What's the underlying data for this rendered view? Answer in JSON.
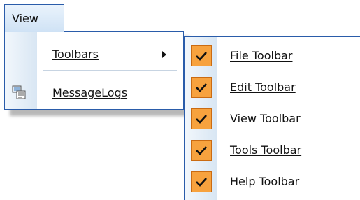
{
  "menubar": {
    "view_label": "View"
  },
  "dropdown": {
    "items": [
      {
        "label": "Toolbars",
        "has_submenu": true
      },
      {
        "label": "MessageLogs",
        "icon": "message-logs-icon"
      }
    ]
  },
  "submenu": {
    "items": [
      {
        "label": "File Toolbar",
        "checked": true
      },
      {
        "label": "Edit Toolbar",
        "checked": true
      },
      {
        "label": "View Toolbar",
        "checked": true
      },
      {
        "label": "Tools Toolbar",
        "checked": true
      },
      {
        "label": "Help Toolbar",
        "checked": true
      }
    ]
  },
  "colors": {
    "border": "#2a5caa",
    "check_bg": "#f7a23e",
    "gutter": "#d8e6f3"
  }
}
